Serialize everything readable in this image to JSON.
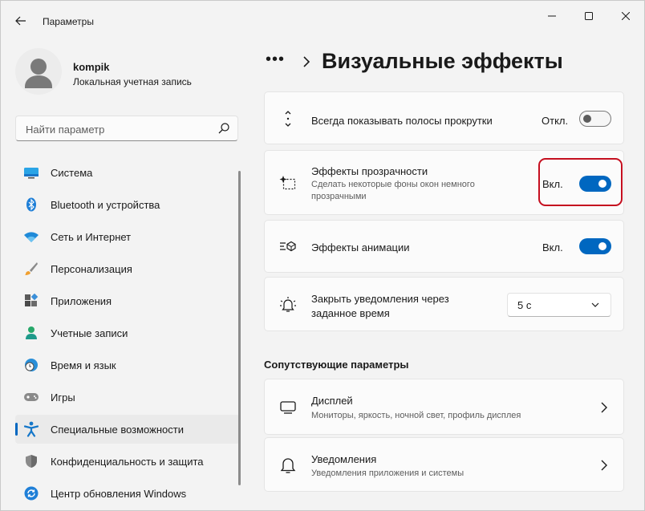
{
  "window": {
    "app_title": "Параметры"
  },
  "user": {
    "name": "kompik",
    "account_type": "Локальная учетная запись"
  },
  "search": {
    "placeholder": "Найти параметр"
  },
  "sidebar": {
    "items": [
      {
        "label": "Система",
        "icon": "monitor-icon"
      },
      {
        "label": "Bluetooth и устройства",
        "icon": "bluetooth-icon"
      },
      {
        "label": "Сеть и Интернет",
        "icon": "wifi-icon"
      },
      {
        "label": "Персонализация",
        "icon": "brush-icon"
      },
      {
        "label": "Приложения",
        "icon": "apps-icon"
      },
      {
        "label": "Учетные записи",
        "icon": "person-icon"
      },
      {
        "label": "Время и язык",
        "icon": "globe-clock-icon"
      },
      {
        "label": "Игры",
        "icon": "gamepad-icon"
      },
      {
        "label": "Специальные возможности",
        "icon": "accessibility-icon",
        "active": true
      },
      {
        "label": "Конфиденциальность и защита",
        "icon": "shield-icon"
      },
      {
        "label": "Центр обновления Windows",
        "icon": "update-icon"
      }
    ]
  },
  "breadcrumb": {
    "ellipsis": "•••",
    "title": "Визуальные эффекты"
  },
  "settings": {
    "scrollbars": {
      "title": "Всегда показывать полосы прокрутки",
      "state": "Откл.",
      "on": false
    },
    "transparency": {
      "title": "Эффекты прозрачности",
      "subtitle": "Сделать некоторые фоны окон немного прозрачными",
      "state": "Вкл.",
      "on": true
    },
    "animation": {
      "title": "Эффекты анимации",
      "state": "Вкл.",
      "on": true
    },
    "notifications_timeout": {
      "title": "Закрыть уведомления через заданное время",
      "value": "5 с"
    }
  },
  "related": {
    "heading": "Сопутствующие параметры",
    "items": [
      {
        "title": "Дисплей",
        "subtitle": "Мониторы, яркость, ночной свет, профиль дисплея"
      },
      {
        "title": "Уведомления",
        "subtitle": "Уведомления приложения и системы"
      }
    ]
  },
  "colors": {
    "accent": "#0067c0",
    "highlight_border": "#c50f1f",
    "background": "#f3f3f3",
    "card": "#fbfbfb"
  }
}
